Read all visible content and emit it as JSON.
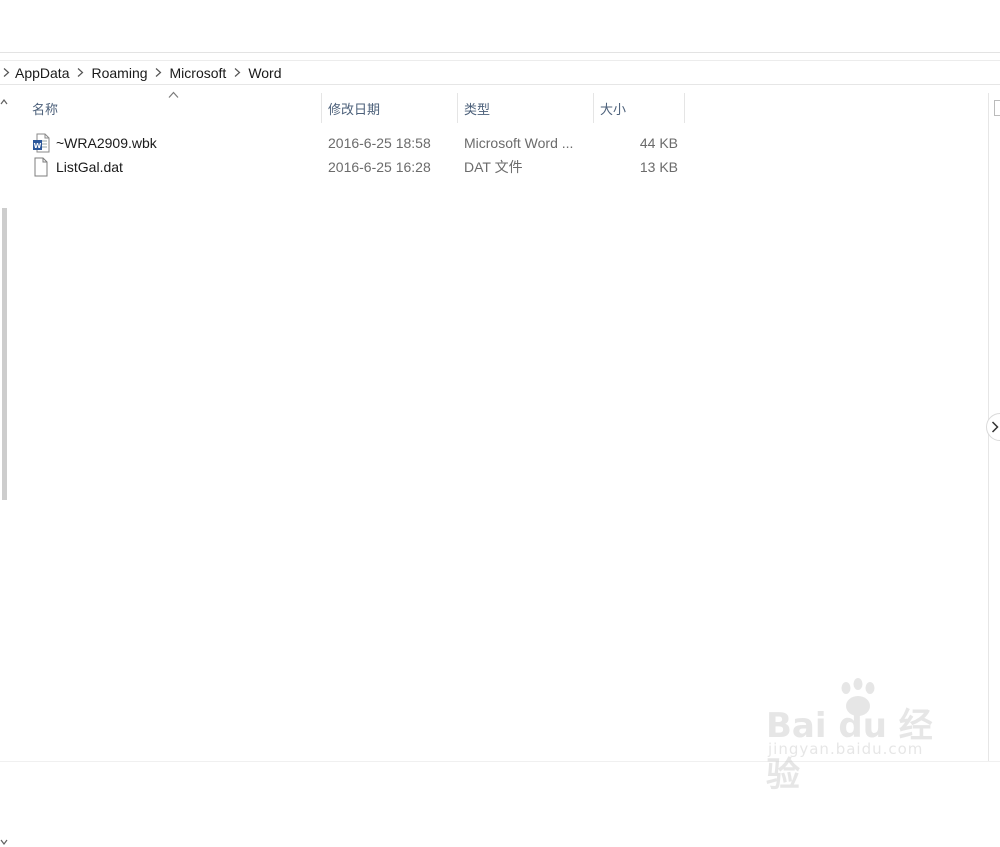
{
  "breadcrumb": [
    "AppData",
    "Roaming",
    "Microsoft",
    "Word"
  ],
  "columns": {
    "name": "名称",
    "date": "修改日期",
    "type": "类型",
    "size": "大小"
  },
  "files": [
    {
      "name": "~WRA2909.wbk",
      "date": "2016-6-25 18:58",
      "type": "Microsoft Word ...",
      "size": "44 KB",
      "icon": "word-document-icon"
    },
    {
      "name": "ListGal.dat",
      "date": "2016-6-25 16:28",
      "type": "DAT 文件",
      "size": "13 KB",
      "icon": "blank-file-icon"
    }
  ],
  "watermark": {
    "brand": "Bai du 经验",
    "url": "jingyan.baidu.com"
  },
  "colors": {
    "header_text": "#4c607a",
    "word_blue": "#2b579a"
  }
}
